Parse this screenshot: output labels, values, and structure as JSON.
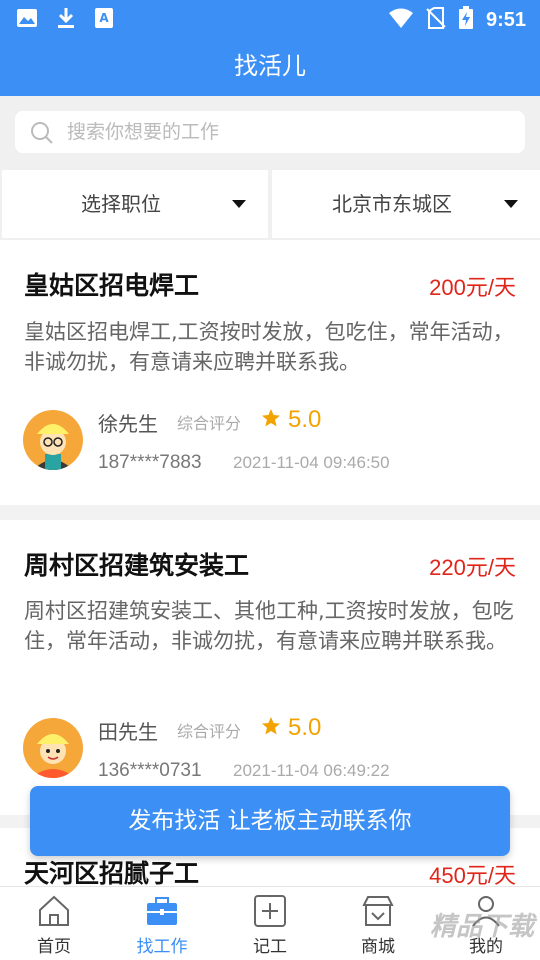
{
  "status_bar": {
    "left_icons": [
      "image-icon",
      "download-icon",
      "translate-icon"
    ],
    "right_icons": [
      "wifi-icon",
      "no-sim-icon",
      "battery-charging-icon"
    ],
    "time": "9:51"
  },
  "header": {
    "title": "找活儿"
  },
  "search": {
    "placeholder": "搜索你想要的工作",
    "value": ""
  },
  "filters": {
    "position": "选择职位",
    "location": "北京市东城区"
  },
  "jobs": [
    {
      "title": "皇姑区招电焊工",
      "salary": "200元/天",
      "description": "皇姑区招电焊工,工资按时发放，包吃住，常年活动，非诚勿扰，有意请来应聘并联系我。",
      "poster": "徐先生",
      "rating_label": "综合评分",
      "rating": "5.0",
      "phone": "187****7883",
      "time": "2021-11-04 09:46:50"
    },
    {
      "title": "周村区招建筑安装工",
      "salary": "220元/天",
      "description": "周村区招建筑安装工、其他工种,工资按时发放，包吃住，常年活动，非诚勿扰，有意请来应聘并联系我。",
      "poster": "田先生",
      "rating_label": "综合评分",
      "rating": "5.0",
      "phone": "136****0731",
      "time": "2021-11-04 06:49:22"
    },
    {
      "title": "天河区招腻子工",
      "salary": "450元/天"
    }
  ],
  "publish_button": "发布找活 让老板主动联系你",
  "tabs": [
    {
      "label": "首页",
      "icon": "home-icon",
      "active": false
    },
    {
      "label": "找工作",
      "icon": "briefcase-icon",
      "active": true
    },
    {
      "label": "记工",
      "icon": "add-record-icon",
      "active": false
    },
    {
      "label": "商城",
      "icon": "shop-icon",
      "active": false
    },
    {
      "label": "我的",
      "icon": "profile-icon",
      "active": false
    }
  ],
  "watermark": "精品下载",
  "colors": {
    "primary": "#3b8ff5",
    "salary": "#e0251a",
    "rating": "#f2a300"
  }
}
